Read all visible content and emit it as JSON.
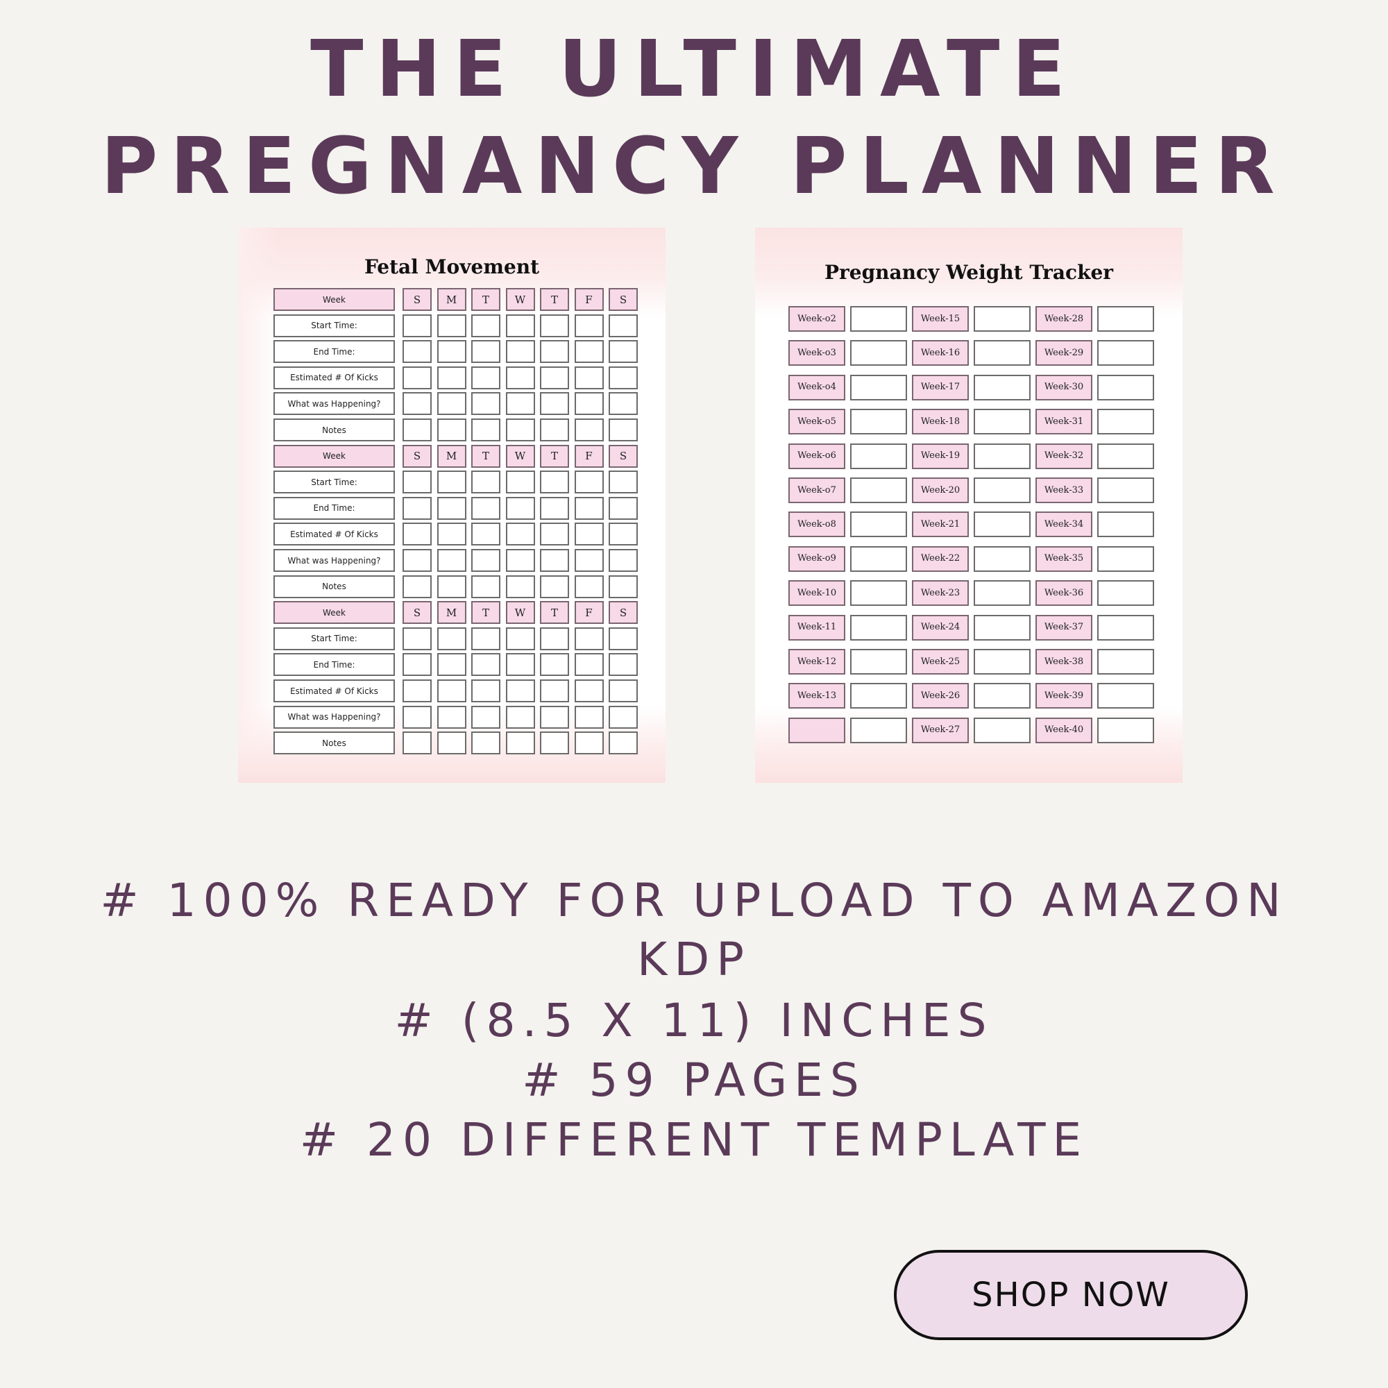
{
  "header": {
    "title_line1": "THE ULTIMATE",
    "title_line2": "PREGNANCY PLANNER"
  },
  "colors": {
    "brand_purple": "#5b3a59",
    "pink_cell": "#f7d9e8",
    "background": "#f4f3ef",
    "button_fill": "#efdcea"
  },
  "fetal_movement": {
    "title": "Fetal Movement",
    "days": [
      "S",
      "M",
      "T",
      "W",
      "T",
      "F",
      "S"
    ],
    "blocks": [
      {
        "rows": [
          "Week",
          "Start Time:",
          "End Time:",
          "Estimated # Of Kicks",
          "What was Happening?",
          "Notes"
        ]
      },
      {
        "rows": [
          "Week",
          "Start Time:",
          "End Time:",
          "Estimated # Of Kicks",
          "What was Happening?",
          "Notes"
        ]
      },
      {
        "rows": [
          "Week",
          "Start Time:",
          "End Time:",
          "Estimated # Of Kicks",
          "What was Happening?",
          "Notes"
        ]
      }
    ]
  },
  "weight_tracker": {
    "title": "Pregnancy Weight Tracker",
    "columns": [
      [
        "Week-o2",
        "Week-o3",
        "Week-o4",
        "Week-o5",
        "Week-o6",
        "Week-o7",
        "Week-o8",
        "Week-o9",
        "Week-10",
        "Week-11",
        "Week-12",
        "Week-13",
        ""
      ],
      [
        "Week-15",
        "Week-16",
        "Week-17",
        "Week-18",
        "Week-19",
        "Week-20",
        "Week-21",
        "Week-22",
        "Week-23",
        "Week-24",
        "Week-25",
        "Week-26",
        "Week-27"
      ],
      [
        "Week-28",
        "Week-29",
        "Week-30",
        "Week-31",
        "Week-32",
        "Week-33",
        "Week-34",
        "Week-35",
        "Week-36",
        "Week-37",
        "Week-38",
        "Week-39",
        "Week-40"
      ]
    ]
  },
  "features": [
    "# 100% READY FOR UPLOAD TO AMAZON",
    "KDP",
    "# (8.5 X 11) INCHES",
    "# 59 PAGES",
    "# 20 DIFFERENT TEMPLATE"
  ],
  "cta": {
    "label": "SHOP NOW"
  }
}
